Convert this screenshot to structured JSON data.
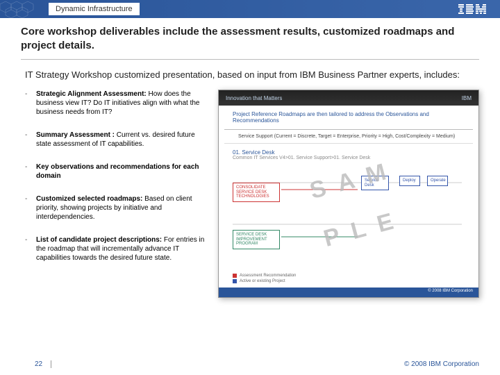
{
  "header": {
    "section_title": "Dynamic Infrastructure",
    "logo_text": "IBM"
  },
  "headline": "Core workshop deliverables include the assessment results, customized roadmaps and project details.",
  "subhead": "IT Strategy Workshop customized presentation, based on input from IBM Business Partner experts, includes:",
  "bullets": [
    {
      "title": "Strategic Alignment Assessment:",
      "body": "How does the business view IT? Do IT initiatives align with what the business needs from IT?"
    },
    {
      "title": "Summary Assessment :",
      "body": "Current vs. desired future state assessment of IT capabilities."
    },
    {
      "title": "Key observations and recommendations for each domain",
      "body": ""
    },
    {
      "title": "Customized selected roadmaps:",
      "body": "Based on client priority, showing projects by initiative and interdependencies."
    },
    {
      "title": "List of candidate project descriptions:",
      "body": "For entries in the roadmap that will incrementally advance IT capabilities towards the desired future state."
    }
  ],
  "sample": {
    "header_left": "Innovation that Matters",
    "header_right": "IBM",
    "title": "Project Reference Roadmaps are then tailored to address the Observations and Recommendations",
    "subline": "Service Support (Current = Discrete, Target = Enterprise, Priority = High, Cost/Complexity = Medium)",
    "section_num": "01. Service Desk",
    "section_sub": "Common IT Services V4>01. Service Support>01. Service Desk",
    "boxes": {
      "r1": "CONSOLIDATE SERVICE DESK TECHNOLOGIES",
      "b1": "Service Desk",
      "g1": "SERVICE DESK IMPROVEMENT PROGRAM",
      "b2": "Deploy",
      "b3": "Operate"
    },
    "legend": {
      "a": "Assessment Recommendation",
      "b": "Active or existing Project"
    },
    "watermark_a": "SAM",
    "watermark_b": "PLE",
    "footer": "© 2008 IBM Corporation"
  },
  "footer": {
    "page": "22",
    "copyright": "© 2008 IBM Corporation"
  }
}
